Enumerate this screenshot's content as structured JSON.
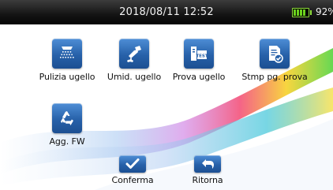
{
  "status_bar": {
    "datetime": "2018/08/11 12:52",
    "battery_percent": "92%",
    "battery_level": 0.92,
    "battery_color": "#6cd21d"
  },
  "menu": {
    "items": [
      {
        "label": "Pulizia ugello",
        "icon": "nozzle-spray-icon"
      },
      {
        "label": "Umid. ugello",
        "icon": "nozzle-wet-icon"
      },
      {
        "label": "Prova ugello",
        "icon": "nozzle-test-icon"
      },
      {
        "label": "Stmp pg. prova",
        "icon": "print-test-page-icon"
      },
      {
        "label": "Agg. FW",
        "icon": "recycle-update-icon"
      }
    ]
  },
  "footer": {
    "confirm_label": "Conferma",
    "return_label": "Ritorna",
    "confirm_icon": "checkmark-icon",
    "return_icon": "return-arrow-icon"
  },
  "colors": {
    "icon_blue": "#2761a9",
    "statusbar_bg": "#141414"
  }
}
